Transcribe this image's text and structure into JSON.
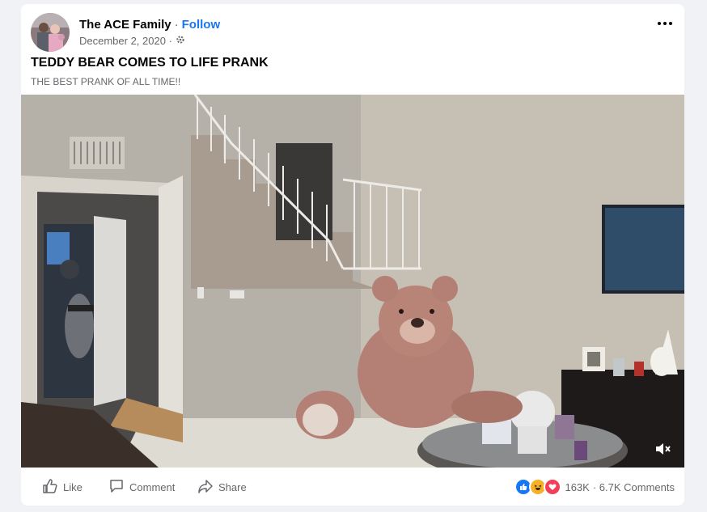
{
  "post": {
    "author": "The ACE Family",
    "separator": "·",
    "follow_label": "Follow",
    "date": "December 2, 2020 ·",
    "title": "TEDDY BEAR COMES TO LIFE PRANK",
    "subtitle": "THE BEST PRANK OF ALL TIME!!"
  },
  "actions": {
    "like": "Like",
    "comment": "Comment",
    "share": "Share"
  },
  "stats": {
    "reactions": "163K",
    "comments": "· 6.7K Comments"
  },
  "colors": {
    "accent": "#1877f2",
    "secondary_text": "#65676b",
    "love": "#f33e58",
    "haha": "#f7b125"
  }
}
